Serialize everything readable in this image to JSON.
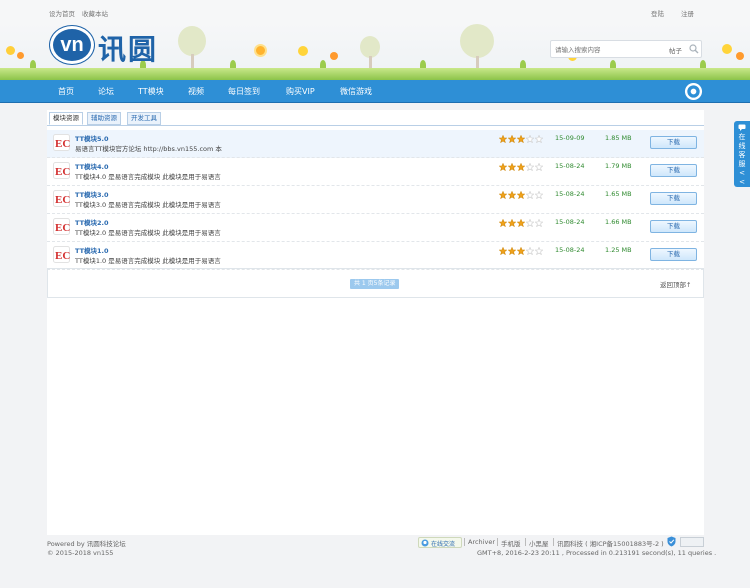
{
  "topbar": {
    "set_homepage": "设为首页",
    "bookmark": "收藏本站",
    "login": "登陆",
    "register": "注册"
  },
  "header": {
    "logo_mark": "vn",
    "logo_text": "讯圆",
    "search": {
      "placeholder": "请输入搜索内容",
      "scope": "帖子"
    }
  },
  "nav": {
    "items": [
      "首页",
      "论坛",
      "TT模块",
      "视频",
      "每日签到",
      "购买VIP",
      "微信游戏"
    ]
  },
  "tabs": [
    "模块资源",
    "辅助资源",
    "开发工具"
  ],
  "rows": [
    {
      "title": "TT模块5.0",
      "desc": "易语言TT模块官方论坛 http://bbs.vn155.com 本",
      "rating": 3,
      "date": "15-09-09",
      "size": "1.85 MB",
      "button": "下载"
    },
    {
      "title": "TT模块4.0",
      "desc": "TT模块4.0 是易语言完成模块 此模块是用于易语言",
      "rating": 3,
      "date": "15-08-24",
      "size": "1.79 MB",
      "button": "下载"
    },
    {
      "title": "TT模块3.0",
      "desc": "TT模块3.0 是易语言完成模块 此模块是用于易语言",
      "rating": 3,
      "date": "15-08-24",
      "size": "1.65 MB",
      "button": "下载"
    },
    {
      "title": "TT模块2.0",
      "desc": "TT模块2.0 是易语言完成模块 此模块是用于易语言",
      "rating": 3,
      "date": "15-08-24",
      "size": "1.66 MB",
      "button": "下载"
    },
    {
      "title": "TT模块1.0",
      "desc": "TT模块1.0 是易语言完成模块 此模块是用于易语言",
      "rating": 3,
      "date": "15-08-24",
      "size": "1.25 MB",
      "button": "下载"
    }
  ],
  "rating_max": 5,
  "pager": {
    "summary": "共 1 页5条记录",
    "back_to_top": "返回顶部↑"
  },
  "side_tab": {
    "label": "在线客服",
    "arrow": "<<"
  },
  "footer": {
    "powered": "Powered by 讯圆科技论坛",
    "copyright": "© 2015-2018 vn155",
    "online_badge": "在线交流",
    "links": [
      "Archiver",
      "手机版",
      "小黑屋",
      "讯圆科技 ( 湘ICP备15001883号-2 )"
    ],
    "stats": "GMT+8, 2016-2-23 20:11 , Processed in 0.213191 second(s), 11 queries ."
  },
  "colors": {
    "nav_bg": "#2e8fd6",
    "brand": "#1f63a8",
    "link": "#2a6ab0",
    "date_green": "#2f8a2f",
    "star": "#f0a21b"
  }
}
